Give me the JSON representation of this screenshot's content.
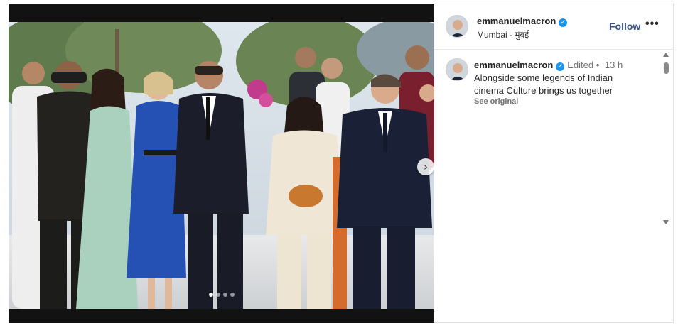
{
  "post": {
    "username": "emmanuelmacron",
    "location": "Mumbai - मुंबई",
    "follow_label": "Follow",
    "more_label": "•••"
  },
  "caption": {
    "username": "emmanuelmacron",
    "edited_label": "Edited •",
    "time_label": "13 h",
    "text": "Alongside some legends of Indian cinema Culture brings us together",
    "see_original": "See original"
  },
  "carousel": {
    "total_slides": 4,
    "active_slide": 1,
    "next_glyph": "›"
  },
  "icons": {
    "verified": "verified-badge-icon",
    "next": "chevron-right-icon",
    "more": "more-horizontal-icon"
  },
  "colors": {
    "follow_link": "#385185",
    "verified": "#1b95f0",
    "media_background": "#121212"
  }
}
